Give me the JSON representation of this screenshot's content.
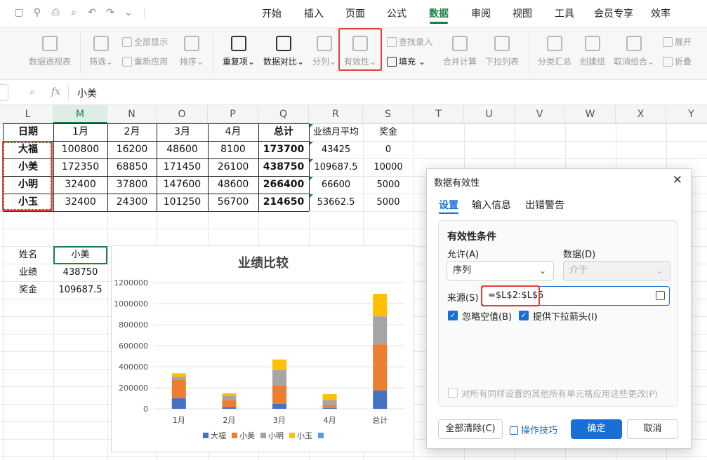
{
  "menubar": {
    "quick_icons": [
      "save-icon",
      "share-icon",
      "print-icon",
      "print-preview-icon",
      "undo-icon",
      "redo-icon",
      "more-icon"
    ],
    "tabs": [
      "开始",
      "插入",
      "页面",
      "公式",
      "数据",
      "审阅",
      "视图",
      "工具",
      "会员专享",
      "效率"
    ],
    "active_tab": "数据"
  },
  "ribbon": {
    "pivot": "数据透视表",
    "filter": "筛选",
    "show_all": "全部显示",
    "reapply": "重新应用",
    "sort": "排序",
    "duplicates": "重复项",
    "compare": "数据对比",
    "split": "分列",
    "validation": "有效性",
    "lookup_entry": "查找录入",
    "fill": "填充",
    "consolidate": "合并计算",
    "dropdown_list": "下拉列表",
    "subtotal": "分类汇总",
    "group": "创建组",
    "ungroup": "取消组合",
    "expand": "展开",
    "collapse": "折叠"
  },
  "formula_bar": {
    "value": "小美"
  },
  "columns": [
    "L",
    "M",
    "N",
    "O",
    "P",
    "Q",
    "R",
    "S",
    "T",
    "U",
    "V",
    "W",
    "X",
    "Y"
  ],
  "table": {
    "headers": [
      "日期",
      "1月",
      "2月",
      "3月",
      "4月",
      "总计",
      "业绩月平均",
      "奖金"
    ],
    "rows": [
      [
        "大福",
        "100800",
        "16200",
        "48600",
        "8100",
        "173700",
        "43425",
        "0"
      ],
      [
        "小美",
        "172350",
        "68850",
        "171450",
        "26100",
        "438750",
        "109687.5",
        "10000"
      ],
      [
        "小明",
        "32400",
        "37800",
        "147600",
        "48600",
        "266400",
        "66600",
        "5000"
      ],
      [
        "小玉",
        "32400",
        "24300",
        "101250",
        "56700",
        "214650",
        "53662.5",
        "5000"
      ]
    ]
  },
  "lookup": {
    "name_label": "姓名",
    "name_value": "小美",
    "perf_label": "业绩",
    "perf_value": "438750",
    "bonus_label": "奖金",
    "bonus_value": "109687.5"
  },
  "chart_data": {
    "type": "bar",
    "stacked": true,
    "title": "业绩比较",
    "categories": [
      "1月",
      "2月",
      "3月",
      "4月",
      "总计"
    ],
    "series": [
      {
        "name": "大福",
        "color": "#4472c4",
        "values": [
          100800,
          16200,
          48600,
          8100,
          173700
        ]
      },
      {
        "name": "小美",
        "color": "#ed7d31",
        "values": [
          172350,
          68850,
          171450,
          26100,
          438750
        ]
      },
      {
        "name": "小明",
        "color": "#a5a5a5",
        "values": [
          32400,
          37800,
          147600,
          48600,
          266400
        ]
      },
      {
        "name": "小玉",
        "color": "#ffc000",
        "values": [
          32400,
          24300,
          101250,
          56700,
          214650
        ]
      },
      {
        "name": "",
        "color": "#5b9bd5",
        "values": [
          0,
          0,
          0,
          0,
          0
        ]
      }
    ],
    "yticks": [
      "0",
      "200000",
      "400000",
      "600000",
      "800000",
      "1000000",
      "1200000"
    ],
    "ylim": [
      0,
      1200000
    ],
    "grid": true,
    "legend": "bottom"
  },
  "dialog": {
    "title": "数据有效性",
    "tabs": [
      "设置",
      "输入信息",
      "出错警告"
    ],
    "section": "有效性条件",
    "allow_label": "允许(A)",
    "allow_value": "序列",
    "data_label": "数据(D)",
    "data_value": "介于",
    "source_label": "来源(S)",
    "source_value": "=$L$2:$L$5",
    "ignore_blank": "忽略空值(B)",
    "dropdown_arrow": "提供下拉箭头(I)",
    "apply_all": "对所有同样设置的其他所有单元格应用这些更改(P)",
    "clear_all": "全部清除(C)",
    "tips": "操作技巧",
    "ok": "确定",
    "cancel": "取消"
  }
}
